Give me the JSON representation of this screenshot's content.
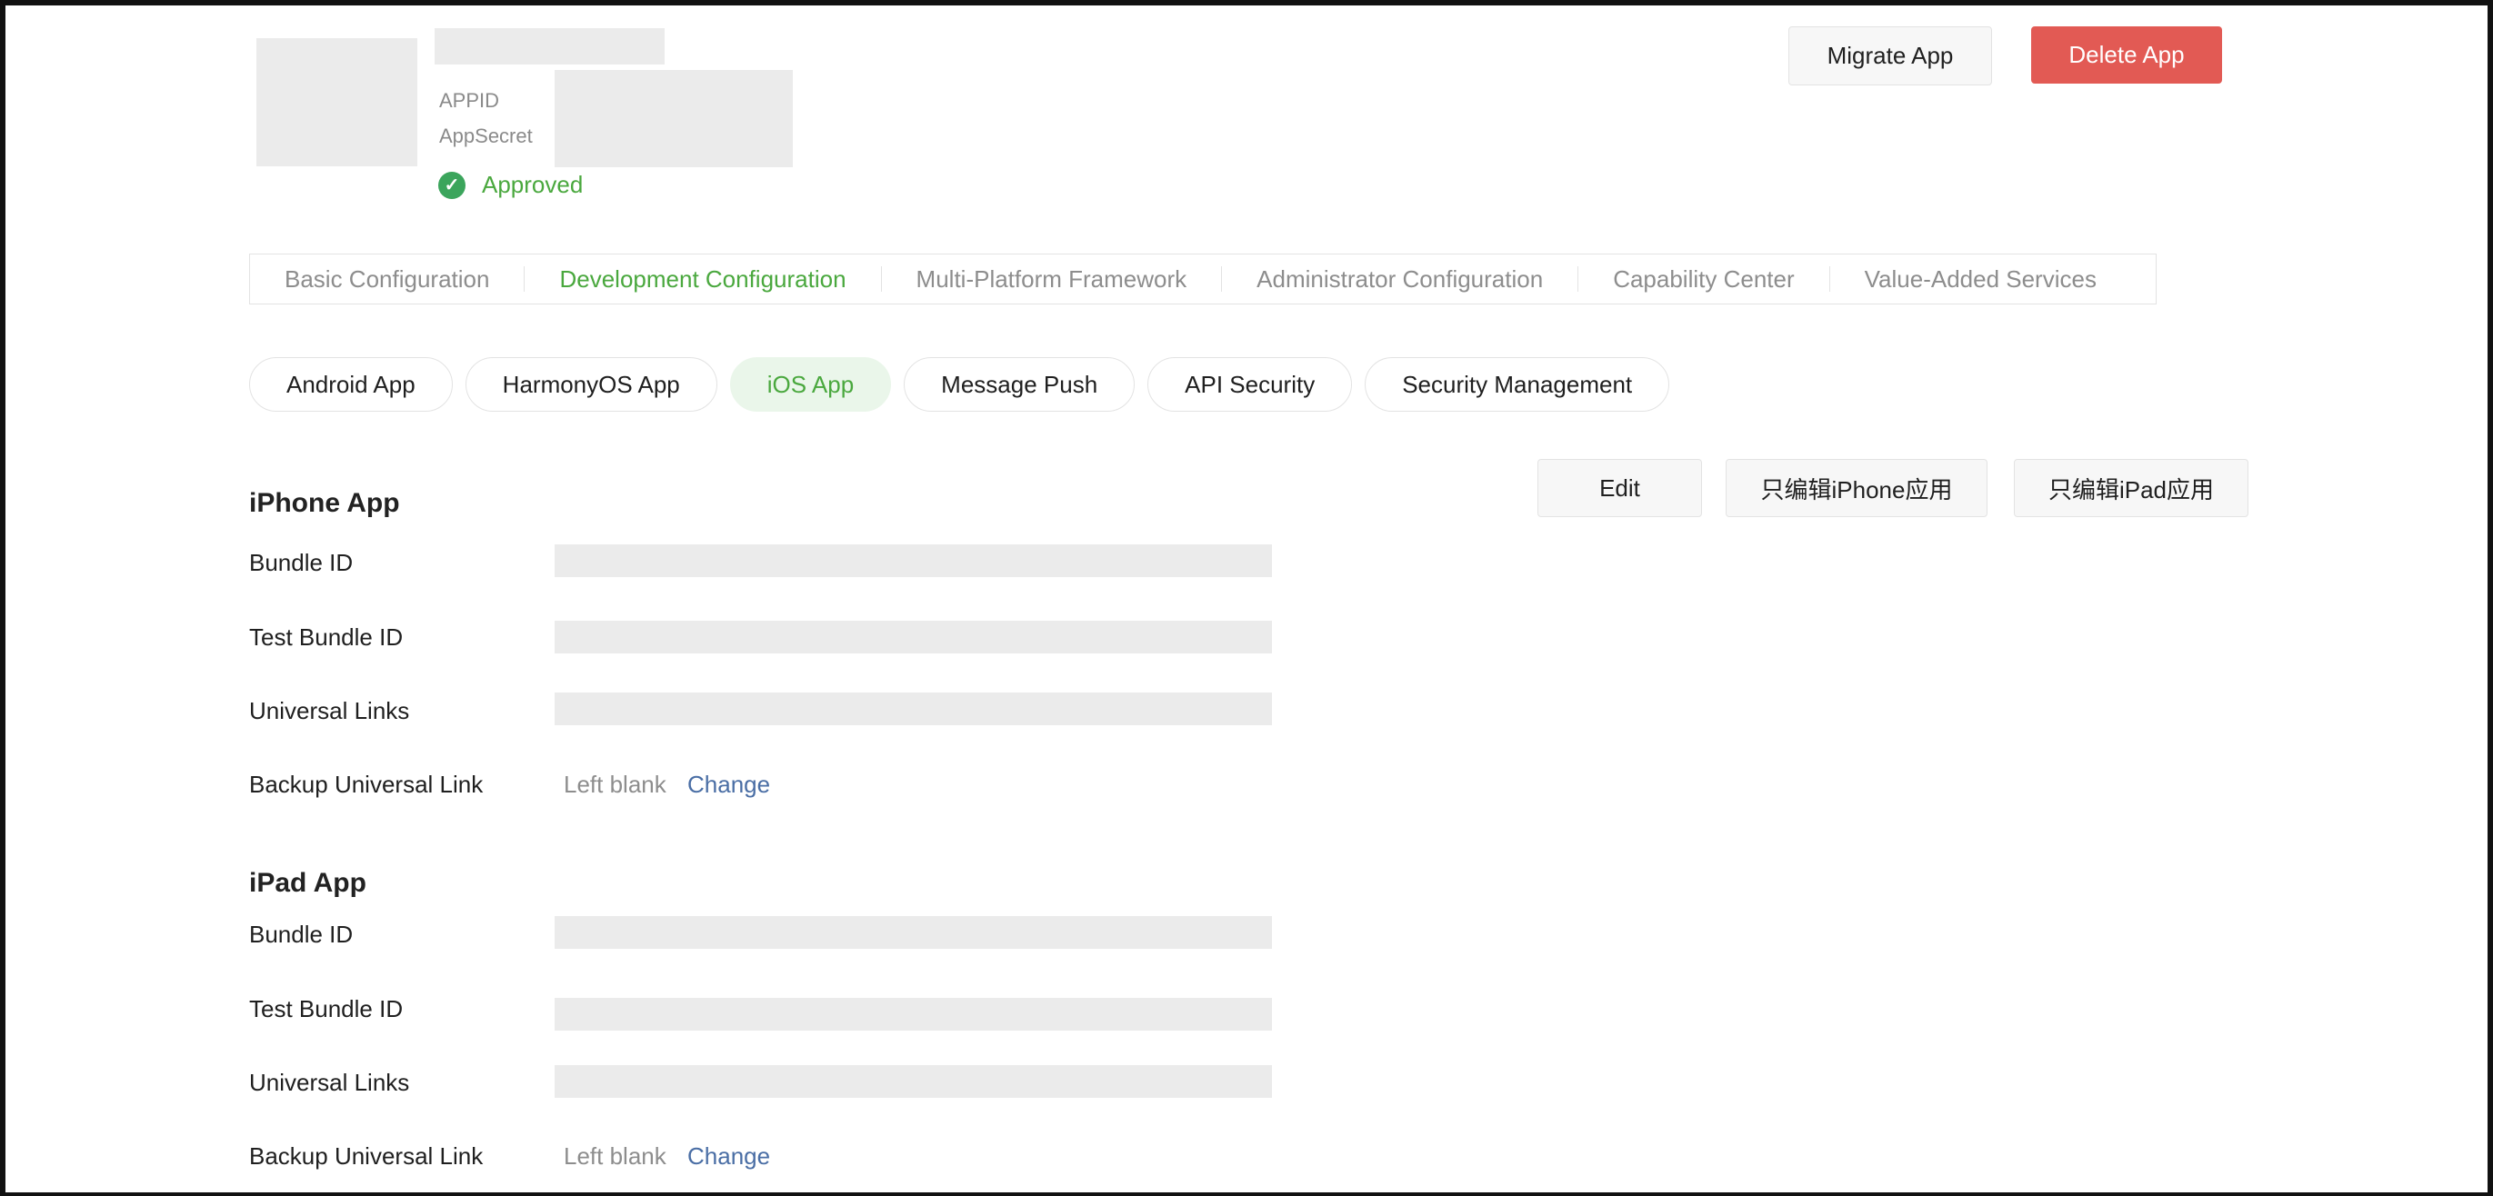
{
  "header": {
    "appid_label": "APPID",
    "appsecret_label": "AppSecret",
    "status": "Approved",
    "migrate_label": "Migrate App",
    "delete_label": "Delete App"
  },
  "main_tabs": [
    {
      "label": "Basic Configuration",
      "active": false
    },
    {
      "label": "Development Configuration",
      "active": true
    },
    {
      "label": "Multi-Platform Framework",
      "active": false
    },
    {
      "label": "Administrator Configuration",
      "active": false
    },
    {
      "label": "Capability Center",
      "active": false
    },
    {
      "label": "Value-Added Services",
      "active": false
    }
  ],
  "sub_tabs": [
    {
      "label": "Android App",
      "active": false
    },
    {
      "label": "HarmonyOS App",
      "active": false
    },
    {
      "label": "iOS App",
      "active": true
    },
    {
      "label": "Message Push",
      "active": false
    },
    {
      "label": "API Security",
      "active": false
    },
    {
      "label": "Security Management",
      "active": false
    }
  ],
  "actions": {
    "edit_label": "Edit",
    "edit_iphone_label": "只编辑iPhone应用",
    "edit_ipad_label": "只编辑iPad应用"
  },
  "iphone": {
    "title": "iPhone App",
    "bundle_id": "Bundle ID",
    "test_bundle_id": "Test Bundle ID",
    "universal_links": "Universal Links",
    "backup_link": "Backup Universal Link",
    "backup_value": "Left blank",
    "change": "Change"
  },
  "ipad": {
    "title": "iPad App",
    "bundle_id": "Bundle ID",
    "test_bundle_id": "Test Bundle ID",
    "universal_links": "Universal Links",
    "backup_link": "Backup Universal Link",
    "backup_value": "Left blank",
    "change": "Change"
  },
  "colors": {
    "accent": "#4aa83e",
    "danger": "#e25a54",
    "link": "#4a6ea5",
    "placeholder": "#ebebeb"
  }
}
